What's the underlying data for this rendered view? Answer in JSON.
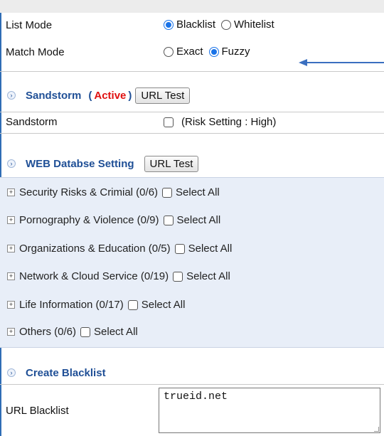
{
  "list_mode": {
    "label": "List Mode",
    "options": [
      "Blacklist",
      "Whitelist"
    ],
    "selected": "Blacklist"
  },
  "match_mode": {
    "label": "Match Mode",
    "options": [
      "Exact",
      "Fuzzy"
    ],
    "selected": "Fuzzy"
  },
  "sandstorm_section": {
    "title": "Sandstorm",
    "status_open": "(",
    "status": "Active",
    "status_close": ")",
    "button": "URL Test"
  },
  "sandstorm_row": {
    "label": "Sandstorm",
    "checkbox_label": "(Risk Setting : High)"
  },
  "web_db_section": {
    "title": "WEB Databse Setting",
    "button": "URL Test"
  },
  "categories": [
    {
      "label": "Security Risks & Crimial (0/6)",
      "select_all": "Select All"
    },
    {
      "label": "Pornography & Violence (0/9)",
      "select_all": "Select All"
    },
    {
      "label": "Organizations & Education (0/5)",
      "select_all": "Select All"
    },
    {
      "label": "Network & Cloud Service (0/19)",
      "select_all": "Select All"
    },
    {
      "label": "Life Information (0/17)",
      "select_all": "Select All"
    },
    {
      "label": "Others (0/6)",
      "select_all": "Select All"
    }
  ],
  "create_blacklist": {
    "title": "Create Blacklist",
    "url_label": "URL Blacklist",
    "url_value": "trueid.net"
  },
  "colors": {
    "accent_border": "#2f6db5",
    "section_title": "#1f4f96",
    "active": "#e01010",
    "category_bg": "#e8eef8",
    "radio_selected": "#1a73e8",
    "annotation_arrow": "#3a6fc0"
  },
  "icons": {
    "section_toggle": "chevron-right-icon",
    "category_expand": "plus-box-icon",
    "annotation": "arrow-left-icon"
  }
}
